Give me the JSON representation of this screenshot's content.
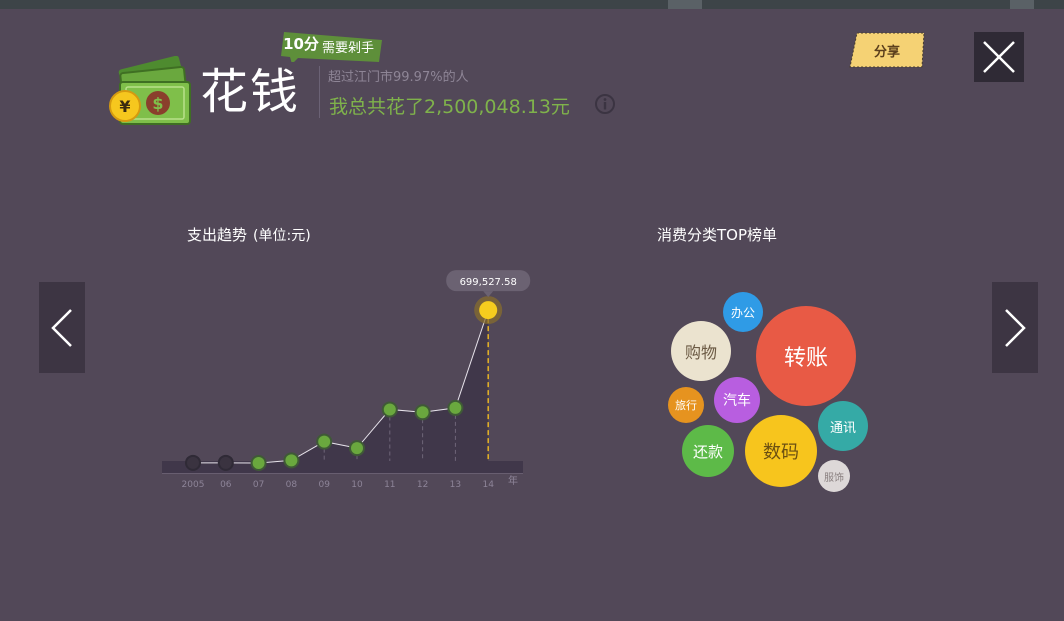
{
  "header": {
    "title": "花钱",
    "score_value": "10分",
    "score_label": "需要剁手",
    "subline": "超过江门市99.97%的人",
    "total": "我总共花了2,500,048.13元"
  },
  "share_label": "分享",
  "trend": {
    "title": "支出趋势",
    "unit": "(单位:元)"
  },
  "categories_title": "消费分类TOP榜单",
  "chart_data": {
    "type": "area",
    "title": "支出趋势",
    "unit": "(单位:元)",
    "x": [
      "2005",
      "06",
      "07",
      "08",
      "09",
      "10",
      "11",
      "12",
      "13",
      "14"
    ],
    "x_suffix": "年",
    "values": [
      800,
      800,
      0,
      12000,
      98000,
      68000,
      245000,
      232000,
      252000,
      699527.58
    ],
    "active_index": 9,
    "active_label": "699,527.58",
    "ylim": [
      0,
      700000
    ],
    "colors": {
      "point": "#6aa83e",
      "inactive": "#3a3340",
      "active": "#f6cd1e",
      "fill": "#40374a"
    }
  },
  "bubbles": [
    {
      "label": "转账",
      "color": "#e85a45",
      "text_color": "#ffffff"
    },
    {
      "label": "购物",
      "color": "#ebe3cf",
      "text_color": "#6b5a44"
    },
    {
      "label": "办公",
      "color": "#2f9be6",
      "text_color": "#ffffff"
    },
    {
      "label": "汽车",
      "color": "#b85ee0",
      "text_color": "#ffffff"
    },
    {
      "label": "旅行",
      "color": "#e6931f",
      "text_color": "#ffffff"
    },
    {
      "label": "数码",
      "color": "#f7c51d",
      "text_color": "#6b4f12"
    },
    {
      "label": "还款",
      "color": "#5dba48",
      "text_color": "#ffffff"
    },
    {
      "label": "通讯",
      "color": "#35aaa6",
      "text_color": "#ffffff"
    },
    {
      "label": "服饰",
      "color": "#ddd8d8",
      "text_color": "#8a8080"
    }
  ]
}
